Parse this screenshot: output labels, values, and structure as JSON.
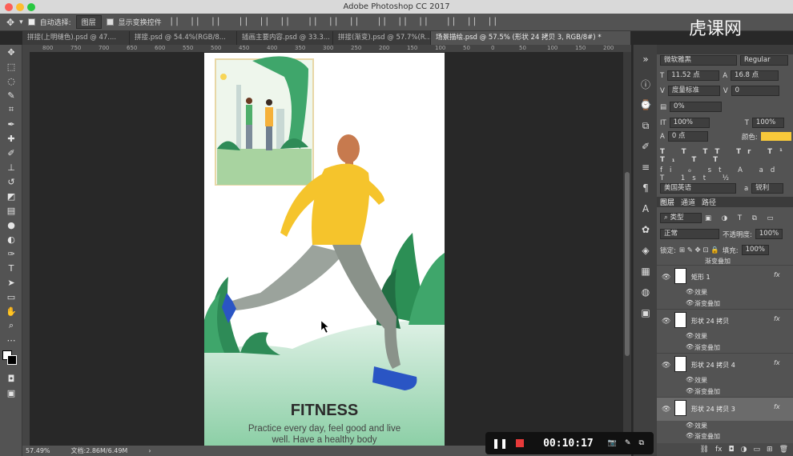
{
  "window": {
    "title": "Adobe Photoshop CC 2017"
  },
  "options": {
    "auto_select": "自动选择:",
    "layer_mode": "图层",
    "transform": "显示变换控件"
  },
  "tabs": [
    "拼接(上明缝色).psd @ 47....",
    "拼接.psd @ 54.4%(RGB/8...",
    "插画主要内容.psd @ 33.3...",
    "拼接(渐变).psd @ 57.7%(R...",
    "场景描绘.psd @ 57.5% (形状 24 拷贝 3, RGB/8#) *"
  ],
  "ruler": [
    "800",
    "750",
    "700",
    "650",
    "600",
    "550",
    "500",
    "450",
    "400",
    "350",
    "300",
    "250",
    "200",
    "150",
    "100",
    "50",
    "0",
    "50",
    "100",
    "150",
    "200"
  ],
  "artwork": {
    "title": "FITNESS",
    "subtitle_line1": "Practice every day, feel good and live",
    "subtitle_line2": "well. Have a healthy body"
  },
  "status": {
    "zoom": "57.49%",
    "doc": "文档:2.86M/6.49M"
  },
  "watermark": "虎课网",
  "recording": {
    "time": "00:10:17"
  },
  "character": {
    "font": "微软雅黑",
    "style": "Regular",
    "size": "11.52 点",
    "leading": "16.8 点",
    "kerning": "度量标准",
    "tracking": "0",
    "scale_pct": "0%",
    "vscale": "100%",
    "hscale": "100%",
    "baseline": "0 点",
    "color_label": "颜色:",
    "lang": "美国英语",
    "aa": "锐利",
    "color": "#f8c93a"
  },
  "layers_panel": {
    "tabs": [
      "图层",
      "通道",
      "路径"
    ],
    "filter": "类型",
    "blend": "正常",
    "opacity_label": "不透明度:",
    "opacity": "100%",
    "lock_label": "锁定:",
    "fill_label": "填充:",
    "fill": "100%",
    "top_effect": "渐变叠加",
    "items": [
      {
        "name": "矩形 1",
        "effects": "效果",
        "overlay": "渐变叠加"
      },
      {
        "name": "形状 24 拷贝",
        "effects": "效果",
        "overlay": "渐变叠加"
      },
      {
        "name": "形状 24 拷贝 4",
        "effects": "效果",
        "overlay": "渐变叠加"
      },
      {
        "name": "形状 24 拷贝 3",
        "effects": "效果",
        "overlay": "渐变叠加"
      }
    ]
  }
}
